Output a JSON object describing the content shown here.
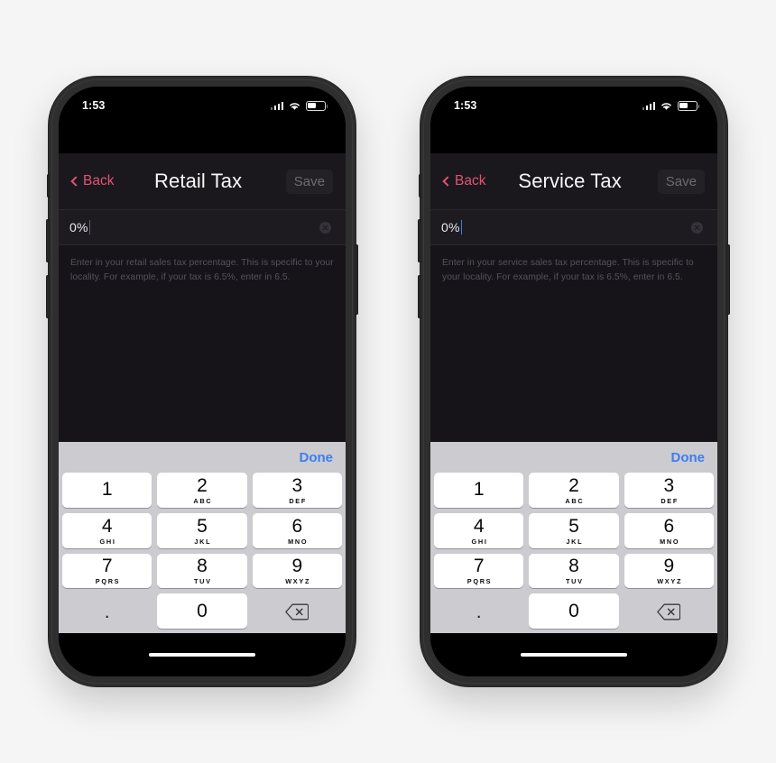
{
  "page": {
    "background_color": "#f5f5f5",
    "accent_pink": "#df5476",
    "accent_blue": "#3c7ef0"
  },
  "keypad": {
    "done_label": "Done",
    "keys": [
      {
        "digit": "1",
        "letters": ""
      },
      {
        "digit": "2",
        "letters": "ABC"
      },
      {
        "digit": "3",
        "letters": "DEF"
      },
      {
        "digit": "4",
        "letters": "GHI"
      },
      {
        "digit": "5",
        "letters": "JKL"
      },
      {
        "digit": "6",
        "letters": "MNO"
      },
      {
        "digit": "7",
        "letters": "PQRS"
      },
      {
        "digit": "8",
        "letters": "TUV"
      },
      {
        "digit": "9",
        "letters": "WXYZ"
      },
      {
        "digit": ".",
        "letters": ""
      },
      {
        "digit": "0",
        "letters": ""
      },
      {
        "digit": "",
        "letters": ""
      }
    ],
    "backspace_icon": "backspace-icon"
  },
  "phones": [
    {
      "status": {
        "time": "1:53",
        "signal_icon": "cellular-signal-icon",
        "wifi_icon": "wifi-icon",
        "battery_icon": "battery-icon",
        "battery_level": "52%"
      },
      "nav": {
        "back_label": "Back",
        "title": "Retail Tax",
        "save_label": "Save"
      },
      "field": {
        "value": "0%",
        "clear_icon": "clear-text-icon"
      },
      "description": "Enter in your retail sales tax percentage. This is specific to your locality. For example, if your tax is 6.5%, enter in 6.5."
    },
    {
      "status": {
        "time": "1:53",
        "signal_icon": "cellular-signal-icon",
        "wifi_icon": "wifi-icon",
        "battery_icon": "battery-icon",
        "battery_level": "52%"
      },
      "nav": {
        "back_label": "Back",
        "title": "Service Tax",
        "save_label": "Save"
      },
      "field": {
        "value": "0%",
        "clear_icon": "clear-text-icon"
      },
      "description": "Enter in your service sales tax percentage. This is specific to your locality. For example, if your tax is 6.5%, enter in 6.5."
    }
  ]
}
